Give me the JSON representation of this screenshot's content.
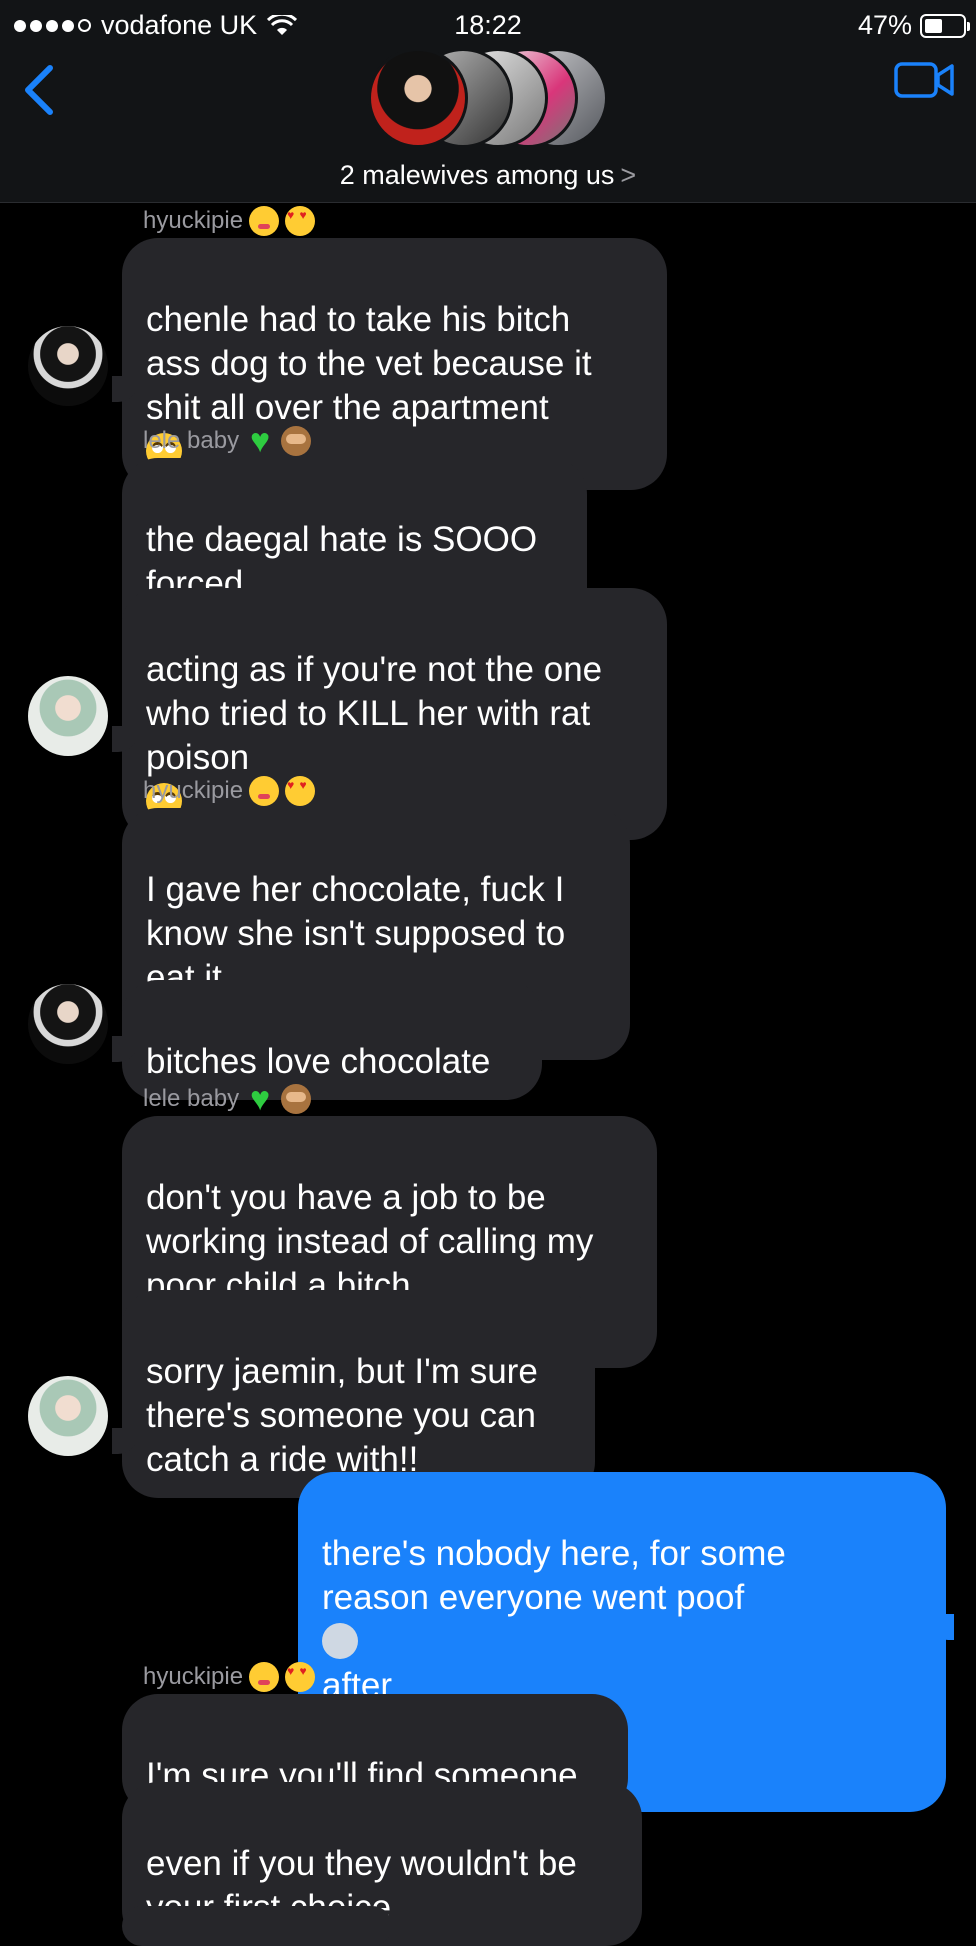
{
  "status_bar": {
    "carrier": "vodafone UK",
    "time": "18:22",
    "battery": "47%",
    "battery_level": 0.47
  },
  "header": {
    "group_name": "2 malewives among us",
    "chevron": ">"
  },
  "icons": {
    "back": "chevron-left-icon",
    "video": "video-camera-icon"
  },
  "colors": {
    "incoming_bubble": "#26262a",
    "outgoing_bubble": "#1a82fb",
    "accent": "#1a82fb",
    "background": "#000000"
  },
  "messages": [
    {
      "sender": "hyuckipie",
      "text": "chenle had to take his bitch\nass dog to the vet because it\nshit all over the apartment",
      "emoji": "eye-roll"
    },
    {
      "sender": "lele baby",
      "text": "the daegal hate is SOOO\nforced",
      "emoji": "thumbs-down"
    },
    {
      "text": "acting as if you're not the one\nwho tried to KILL her with rat\npoison",
      "emoji": "eye-roll"
    },
    {
      "sender": "hyuckipie",
      "text": "I gave her chocolate, fuck I\nknow she isn't supposed to\neat it",
      "emoji": "eye-roll"
    },
    {
      "text": "bitches love chocolate"
    },
    {
      "sender": "lele baby",
      "text": "don't you have a job to be\nworking instead of calling my\npoor child a bitch",
      "emoji": "angry"
    },
    {
      "text": "sorry jaemin, but I'm sure\nthere's someone you can\ncatch a ride with!!"
    },
    {
      "text_a": "there's nobody here, for some\nreason everyone went poof",
      "text_b": "after\npractise",
      "emoji": "sad",
      "outgoing": true
    },
    {
      "sender": "hyuckipie",
      "text": "I'm sure you'll find someone"
    },
    {
      "text": "even if you they wouldn't be\nyour first choice"
    }
  ]
}
